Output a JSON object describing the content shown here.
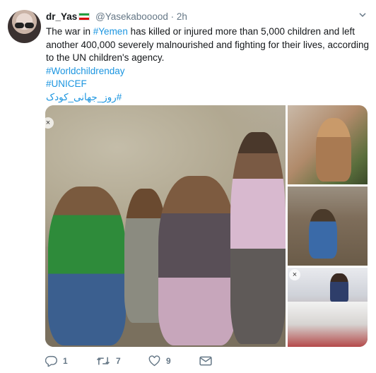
{
  "author": {
    "name": "dr_Yas",
    "handle": "@Yasekabooood",
    "separator": "·",
    "time": "2h"
  },
  "tweet": {
    "text_before_link": "The war in ",
    "link_yemen": "#Yemen",
    "text_after_link": " has killed or injured more than 5,000 children and left another 400,000 severely malnourished and fighting for their lives, according to the UN children's agency.",
    "hashtags": [
      "#Worldchildrenday",
      "#UNICEF",
      "#روز_جهانی_کودک"
    ]
  },
  "media": {
    "close_glyph": "×"
  },
  "actions": {
    "reply_count": "1",
    "retweet_count": "7",
    "like_count": "9"
  },
  "icons": {
    "reply": "reply-icon",
    "retweet": "retweet-icon",
    "like": "heart-icon",
    "dm": "envelope-icon",
    "caret": "chevron-down-icon"
  },
  "colors": {
    "link": "#1b95e0",
    "muted": "#657786",
    "text": "#14171a"
  }
}
